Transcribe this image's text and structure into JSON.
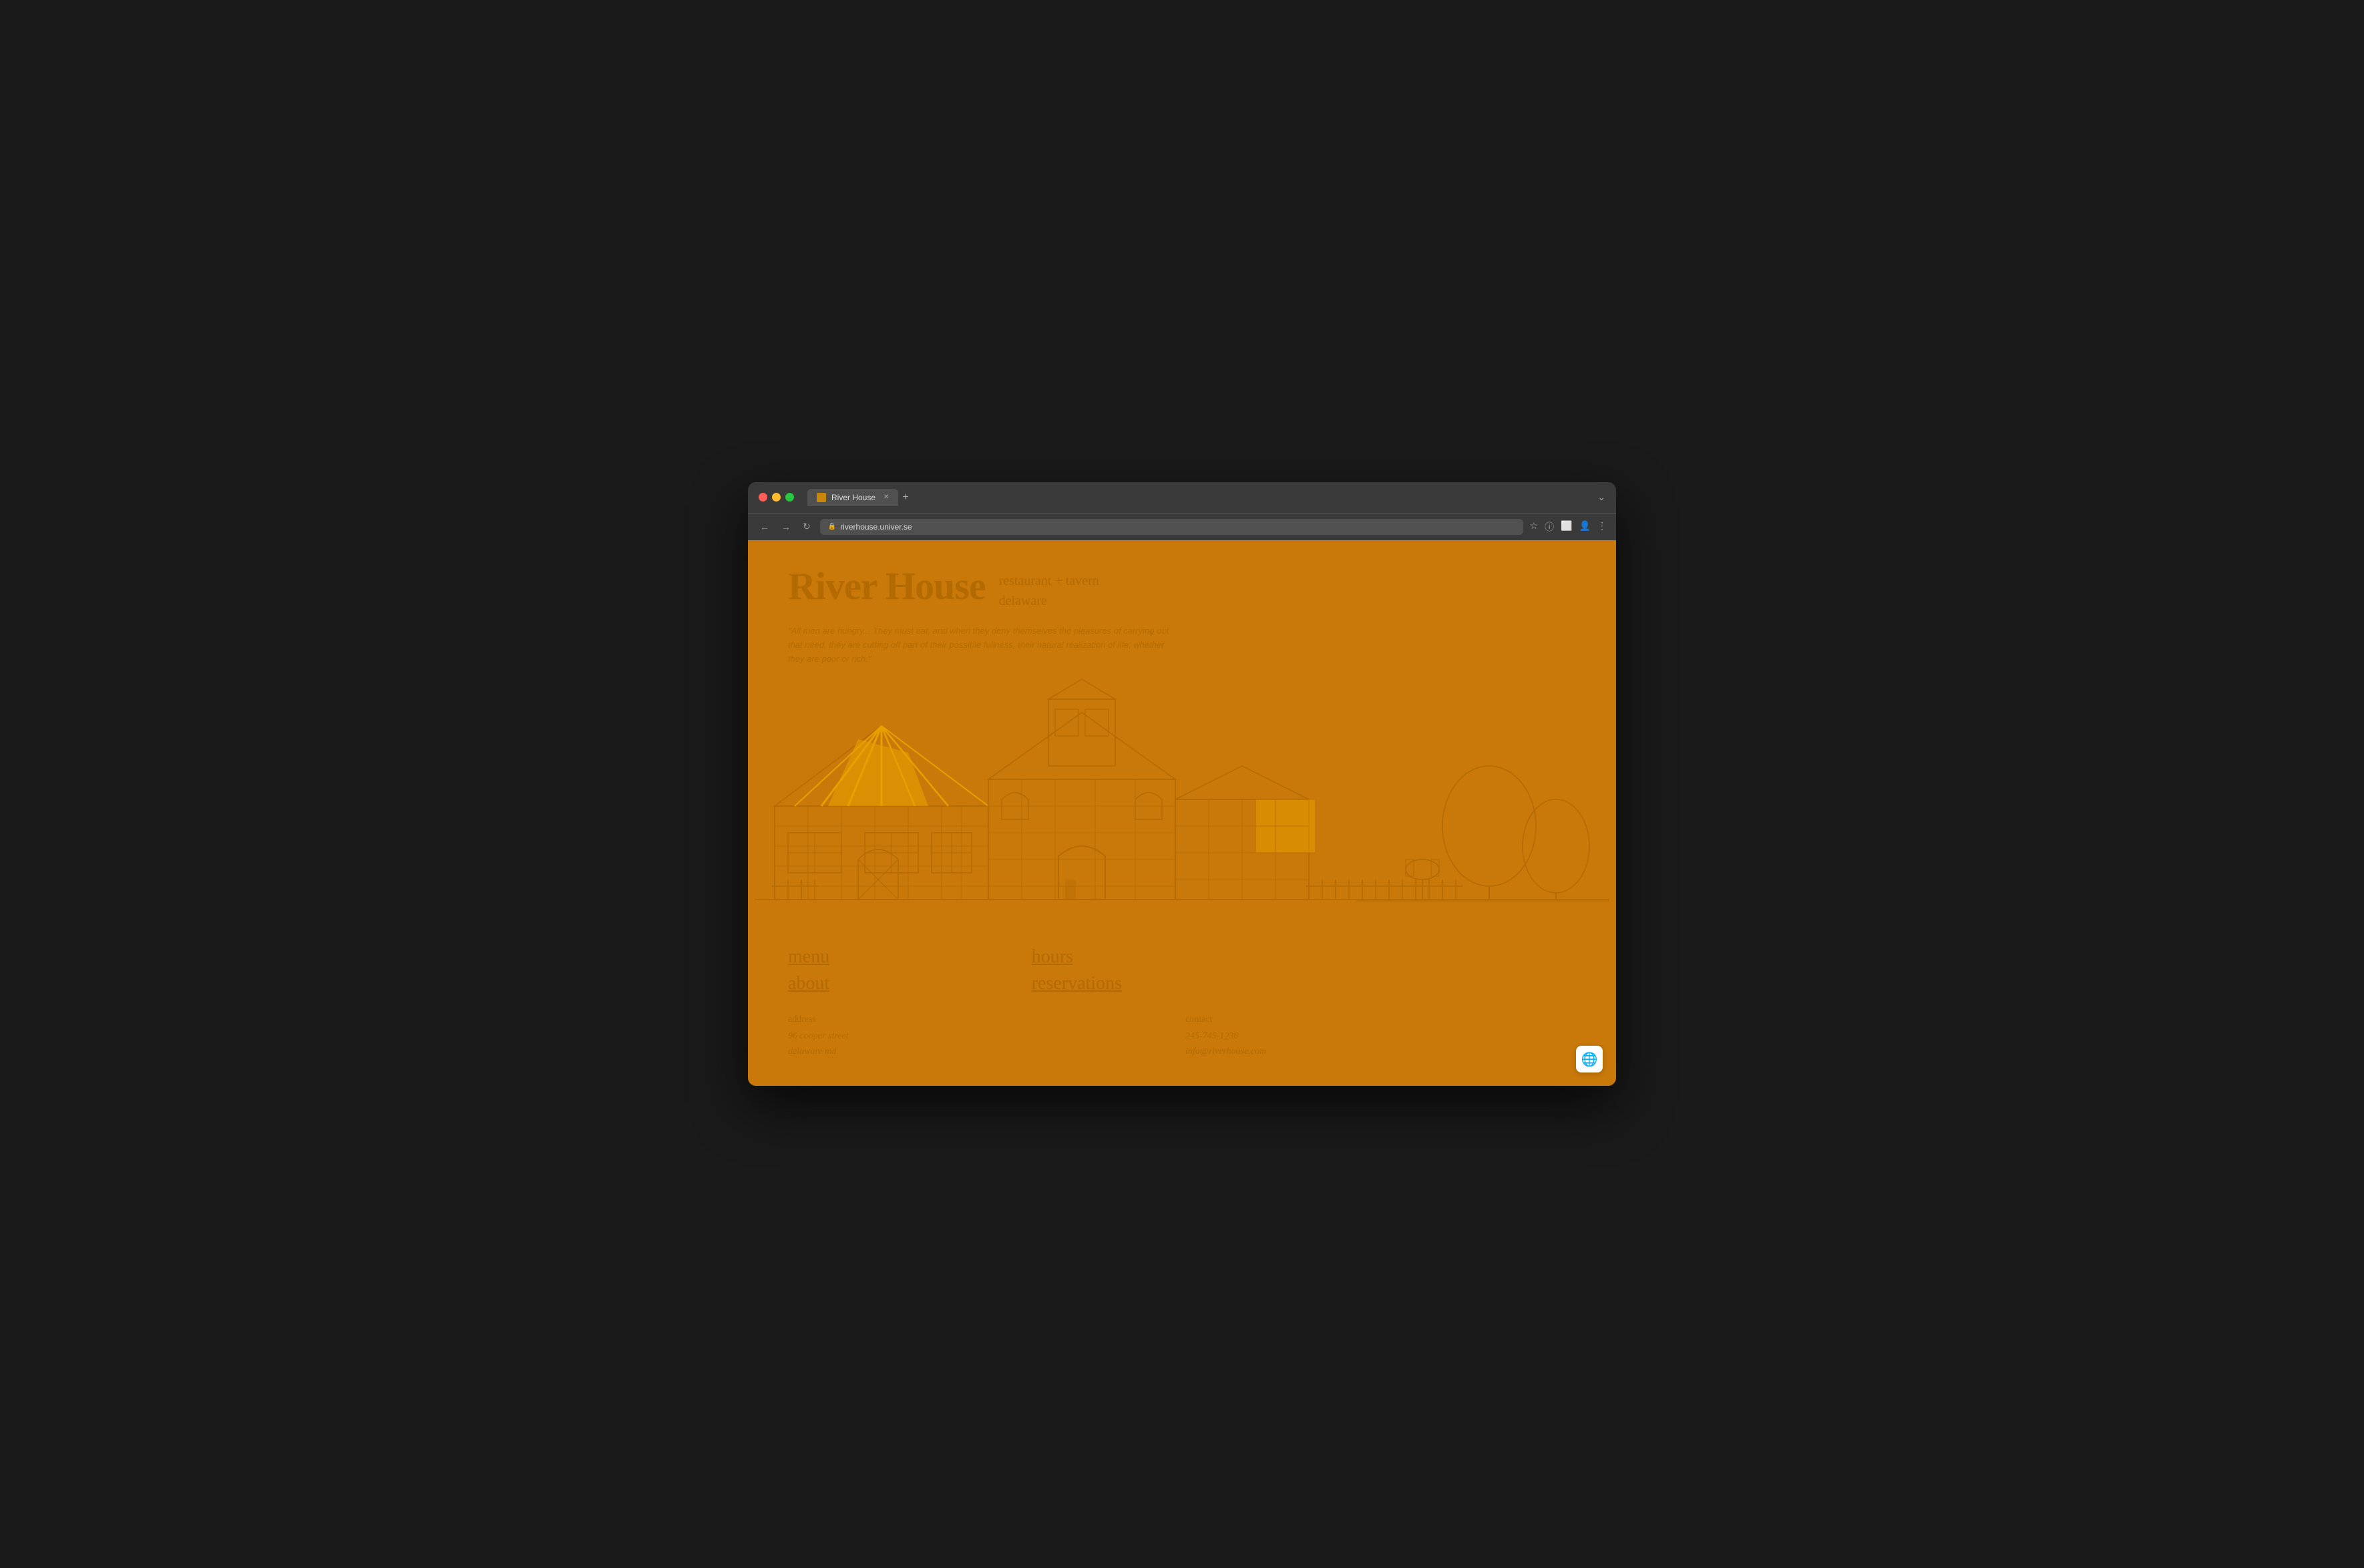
{
  "browser": {
    "tab_title": "River House",
    "url": "riverhouse.univer.se",
    "new_tab_symbol": "+",
    "nav_back": "←",
    "nav_forward": "→",
    "nav_reload": "↻"
  },
  "site": {
    "title": "River House",
    "subtitle_line1": "restaurant + tavern",
    "subtitle_line2": "delaware",
    "quote": "\"All men are hungry... They must eat, and when they deny themselves the pleasures of carrying out that need, they are cutting off part of their possible fullness, their natural realization of life, whether they are poor or rich.\"",
    "nav": {
      "menu": "menu",
      "about": "about",
      "hours": "hours",
      "reservations": "reservations"
    },
    "footer": {
      "address_label": "address",
      "address_line1": "96 cooper street",
      "address_line2": "delaware md",
      "contact_label": "contact",
      "phone": "245-745-1236",
      "email": "info@riverhouse.com"
    }
  },
  "colors": {
    "bg": "#c8790a",
    "text": "#b36a00",
    "accent": "#e8a000"
  }
}
